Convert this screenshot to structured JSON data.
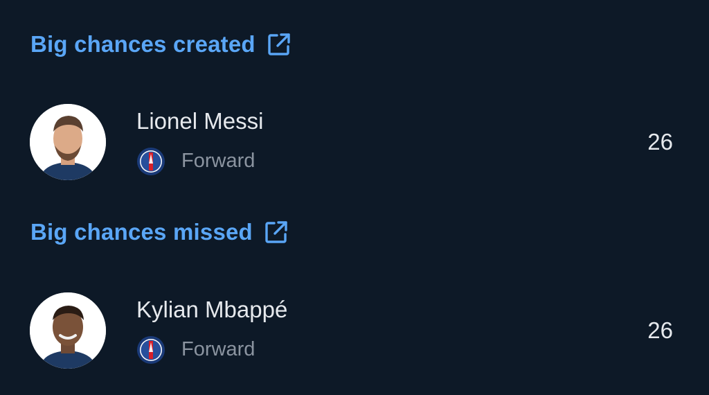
{
  "sections": [
    {
      "title": "Big chances created",
      "icon": "external-link-icon",
      "player": {
        "name": "Lionel Messi",
        "position": "Forward",
        "club_icon": "psg-badge-icon",
        "value": "26"
      }
    },
    {
      "title": "Big chances missed",
      "icon": "external-link-icon",
      "player": {
        "name": "Kylian Mbappé",
        "position": "Forward",
        "club_icon": "psg-badge-icon",
        "value": "26"
      }
    }
  ],
  "colors": {
    "background": "#0d1927",
    "accent": "#5aa6f6",
    "primary_text": "#e6e9ed",
    "secondary_text": "#8b94a0"
  }
}
